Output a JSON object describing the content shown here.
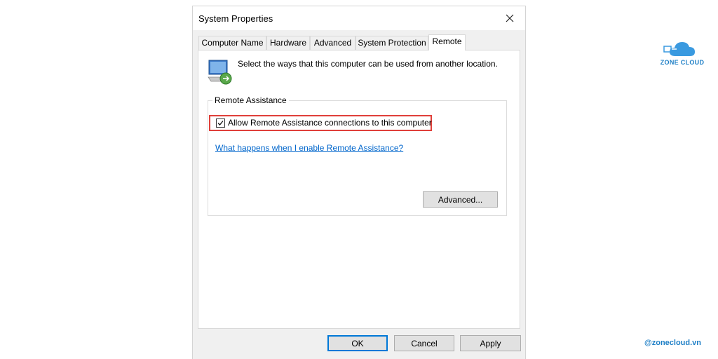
{
  "window": {
    "title": "System Properties"
  },
  "tabs": [
    {
      "label": "Computer Name"
    },
    {
      "label": "Hardware"
    },
    {
      "label": "Advanced"
    },
    {
      "label": "System Protection"
    },
    {
      "label": "Remote",
      "active": true
    }
  ],
  "remote": {
    "intro_text": "Select the ways that this computer can be used from another location.",
    "group_label": "Remote Assistance",
    "allow_label": "Allow Remote Assistance connections to this computer",
    "allow_checked": true,
    "help_link": "What happens when I enable Remote Assistance?",
    "advanced_button": "Advanced..."
  },
  "footer": {
    "ok": "OK",
    "cancel": "Cancel",
    "apply": "Apply"
  },
  "branding": {
    "logo_text": "ZONE CLOUD",
    "handle": "@zonecloud.vn"
  },
  "colors": {
    "highlight": "#e0403a",
    "link": "#0066cc",
    "brand": "#1e7fc6",
    "focus": "#0078d7"
  }
}
